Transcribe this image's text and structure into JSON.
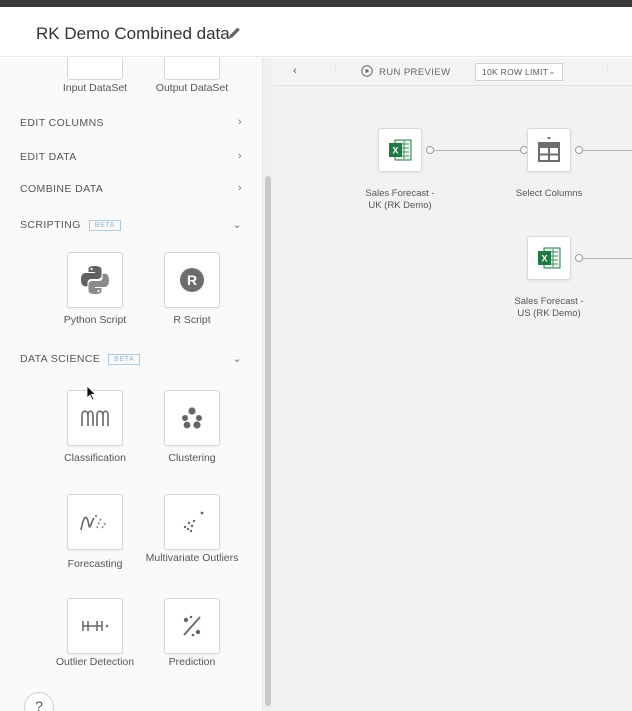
{
  "header": {
    "title": "RK Demo Combined data"
  },
  "sidebar": {
    "top_tiles": [
      {
        "label": "Input DataSet",
        "icon": "input-dataset-icon"
      },
      {
        "label": "Output DataSet",
        "icon": "output-dataset-icon"
      }
    ],
    "sections": [
      {
        "label": "EDIT COLUMNS",
        "expanded": false
      },
      {
        "label": "EDIT DATA",
        "expanded": false
      },
      {
        "label": "COMBINE DATA",
        "expanded": false
      },
      {
        "label": "SCRIPTING",
        "badge": "BETA",
        "expanded": true
      },
      {
        "label": "DATA SCIENCE",
        "badge": "BETA",
        "expanded": true
      }
    ],
    "scripting_tiles": [
      {
        "label": "Python Script",
        "icon": "python-icon"
      },
      {
        "label": "R Script",
        "icon": "r-icon"
      }
    ],
    "data_science_tiles": [
      {
        "label": "Classification",
        "icon": "classification-icon"
      },
      {
        "label": "Clustering",
        "icon": "clustering-icon"
      },
      {
        "label": "Forecasting",
        "icon": "forecasting-icon"
      },
      {
        "label": "Multivariate Outliers",
        "icon": "multivariate-outliers-icon"
      },
      {
        "label": "Outlier Detection",
        "icon": "outlier-detection-icon"
      },
      {
        "label": "Prediction",
        "icon": "prediction-icon"
      }
    ],
    "help_label": "?"
  },
  "toolbar": {
    "run_preview": "RUN PREVIEW",
    "row_limit": "10K ROW LIMIT"
  },
  "canvas": {
    "nodes": [
      {
        "label_line1": "Sales Forecast -",
        "label_line2": "UK (RK Demo)",
        "icon": "excel-icon"
      },
      {
        "label_line1": "Select Columns",
        "label_line2": "",
        "icon": "select-columns-icon"
      },
      {
        "label_line1": "Sales Forecast -",
        "label_line2": "US (RK Demo)",
        "icon": "excel-icon"
      }
    ]
  },
  "colors": {
    "excel_green": "#1f7a45",
    "beta_blue": "#86b7dc",
    "canvas_bg": "#f2f2f2",
    "sidebar_bg": "#fafafa"
  }
}
